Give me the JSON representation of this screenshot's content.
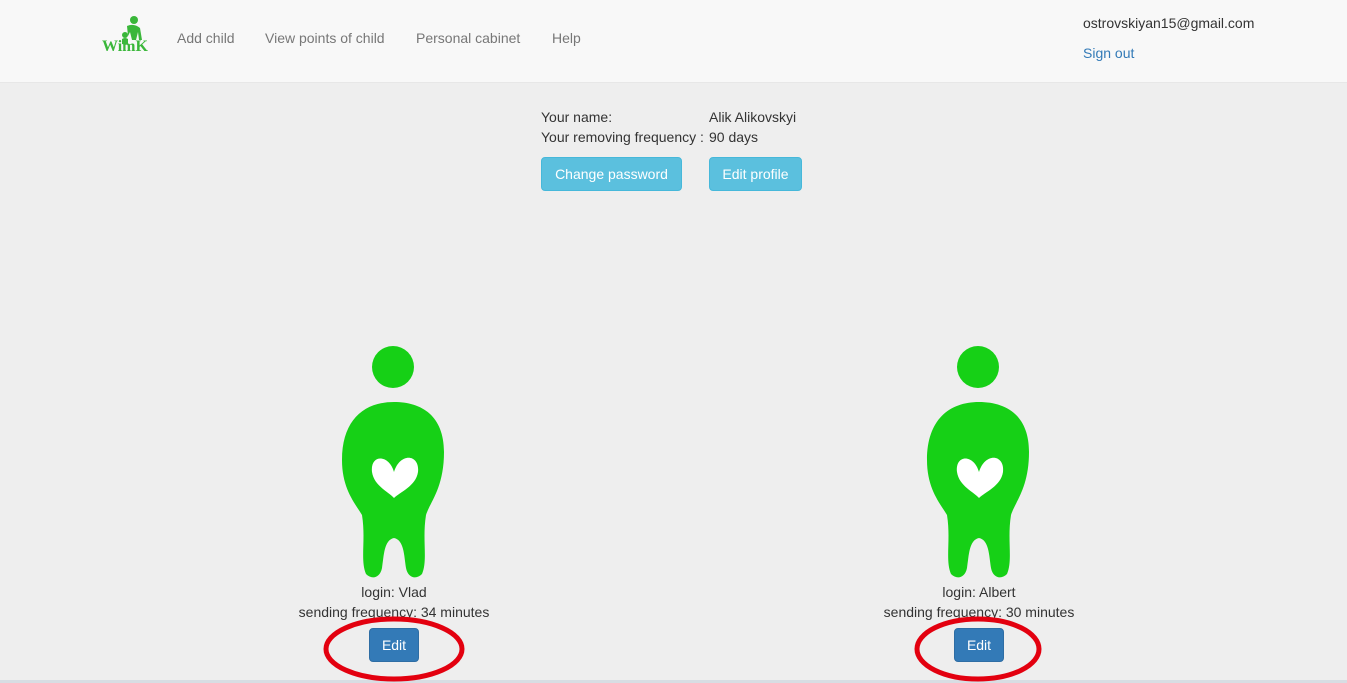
{
  "navbar": {
    "brand_label": "WimK",
    "links": [
      "Add child",
      "View points of child",
      "Personal cabinet",
      "Help"
    ],
    "user_email": "ostrovskiyan15@gmail.com",
    "sign_out": "Sign out"
  },
  "profile": {
    "name_label": "Your name:",
    "name_value": "Alik Alikovskyi",
    "frequency_label": "Your removing frequency :",
    "frequency_value": "90 days",
    "change_password": "Change password",
    "edit_profile": "Edit profile"
  },
  "children": [
    {
      "login": "login: Vlad",
      "frequency": "sending frequency: 34 minutes",
      "edit": "Edit"
    },
    {
      "login": "login: Albert",
      "frequency": "sending frequency: 30 minutes",
      "edit": "Edit"
    }
  ],
  "colors": {
    "brand_green": "#3ab73a",
    "figure_green": "#16d016",
    "primary_blue": "#337ab7",
    "info_blue": "#5bc0de",
    "highlight_red": "#e3000f"
  },
  "icons": {
    "logo": "wimk-logo-icon",
    "child_figure": "child-figure-icon"
  }
}
